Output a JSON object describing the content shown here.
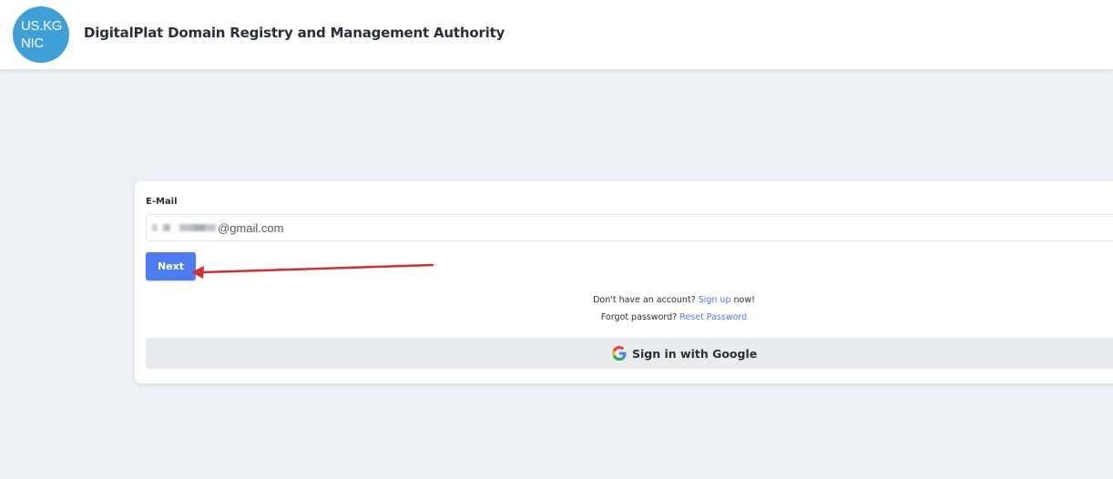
{
  "header": {
    "logo_line1": "US.KG",
    "logo_line2": "NIC",
    "title": "DigitalPlat Domain Registry and Management Authority"
  },
  "login": {
    "email_label": "E-Mail",
    "email_value_visible": "@gmail.com",
    "next_label": "Next",
    "signup_prefix": "Don't have an account?",
    "signup_link": "Sign up",
    "signup_suffix": "now!",
    "forgot_prefix": "Forgot password?",
    "forgot_link": "Reset Password",
    "google_label": "Sign in with Google"
  },
  "colors": {
    "logo_bg": "#3f9fd8",
    "primary": "#4d7df0",
    "annotation_arrow": "#d32f2f"
  },
  "icons": {
    "google": "google-g-icon",
    "annotation": "red-arrow-annotation"
  }
}
